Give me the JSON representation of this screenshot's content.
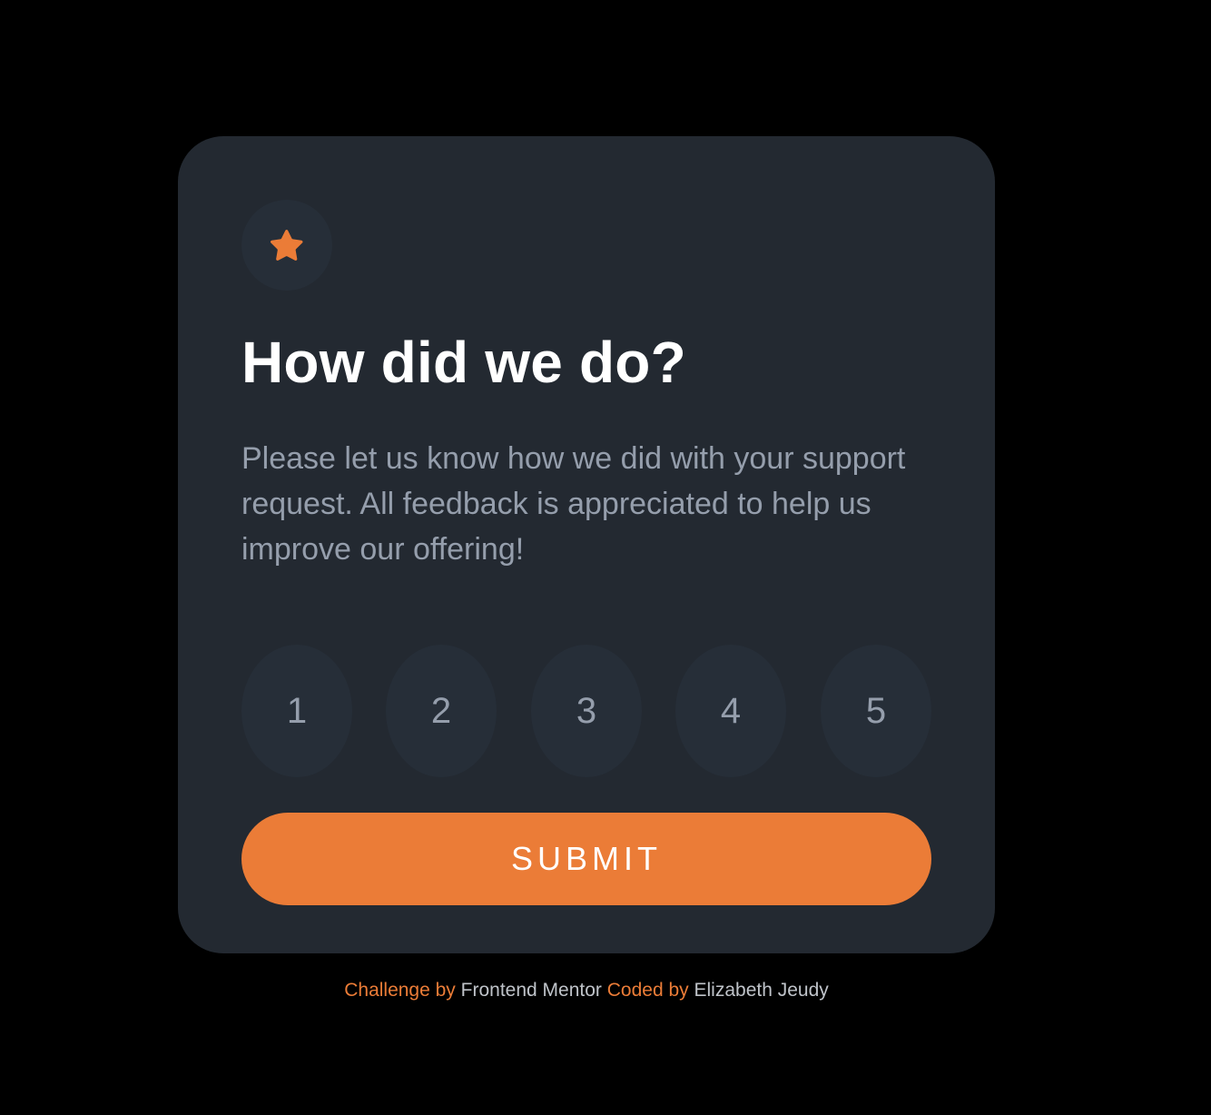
{
  "colors": {
    "background": "#000000",
    "card": "#232931",
    "circle": "#262e38",
    "accent": "#eb7c37",
    "heading": "#ffffff",
    "muted": "#959eac"
  },
  "card": {
    "icon": "star-icon",
    "title": "How did we do?",
    "description": "Please let us know how we did with your support request. All feedback is appreciated to help us improve our offering!",
    "ratings": [
      "1",
      "2",
      "3",
      "4",
      "5"
    ],
    "submit_label": "SUBMIT"
  },
  "attribution": {
    "challenge_prefix": "Challenge by",
    "challenge_link": "Frontend Mentor",
    "coded_prefix": "Coded by",
    "coded_link": "Elizabeth Jeudy"
  }
}
